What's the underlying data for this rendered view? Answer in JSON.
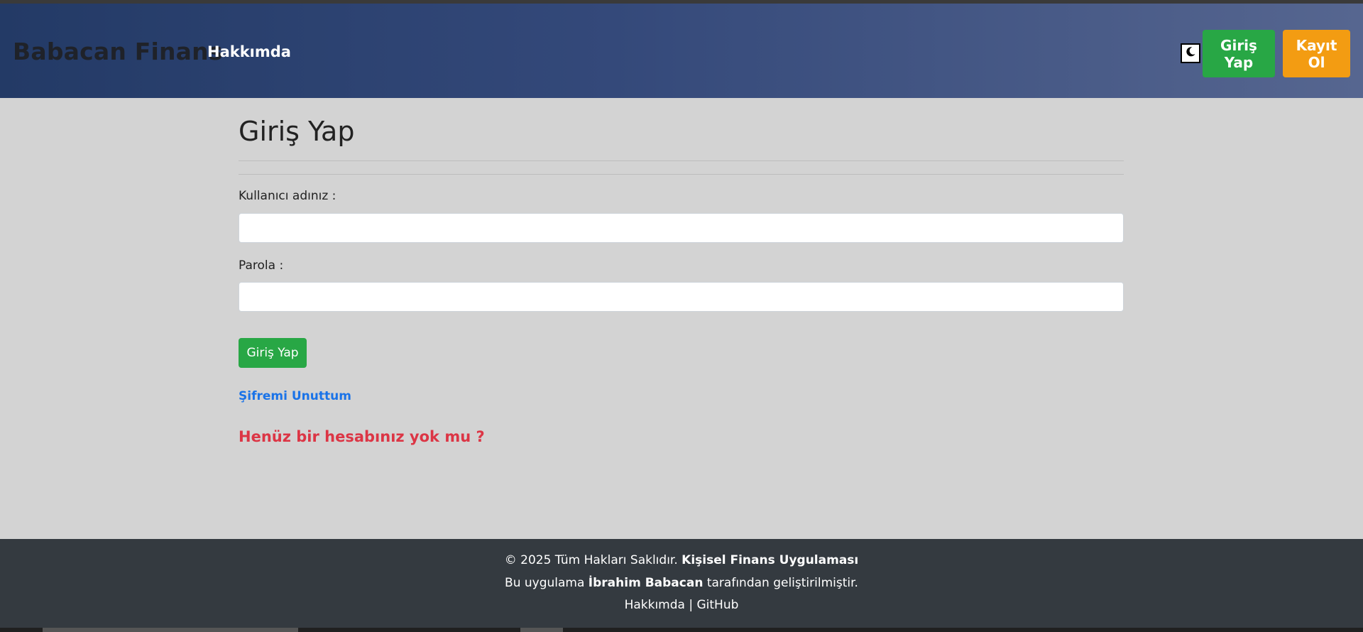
{
  "header": {
    "brand": "Babacan Finans",
    "nav_about": "Hakkımda",
    "theme_icon": "moon-icon",
    "login_label": "Giriş Yap",
    "register_label": "Kayıt Ol",
    "colors": {
      "login": "#28a745",
      "register": "#f39c12",
      "navbar_start": "#233a66",
      "navbar_end": "#566690"
    }
  },
  "main": {
    "title": "Giriş Yap",
    "username_label": "Kullanıcı adınız :",
    "username_value": "",
    "password_label": "Parola :",
    "password_value": "",
    "submit_label": "Giriş Yap",
    "forgot_link": "Şifremi Unuttum",
    "no_account_link": "Henüz bir hesabınız yok mu ?"
  },
  "footer": {
    "copyright_prefix": "© 2025 Tüm Hakları Saklıdır.",
    "app_name": "Kişisel Finans Uygulaması",
    "made_by_prefix": "Bu uygulama",
    "author": "İbrahim Babacan",
    "made_by_suffix": "tarafından geliştirilmiştir.",
    "about_link": "Hakkımda",
    "separator": "|",
    "github_link": "GitHub"
  }
}
